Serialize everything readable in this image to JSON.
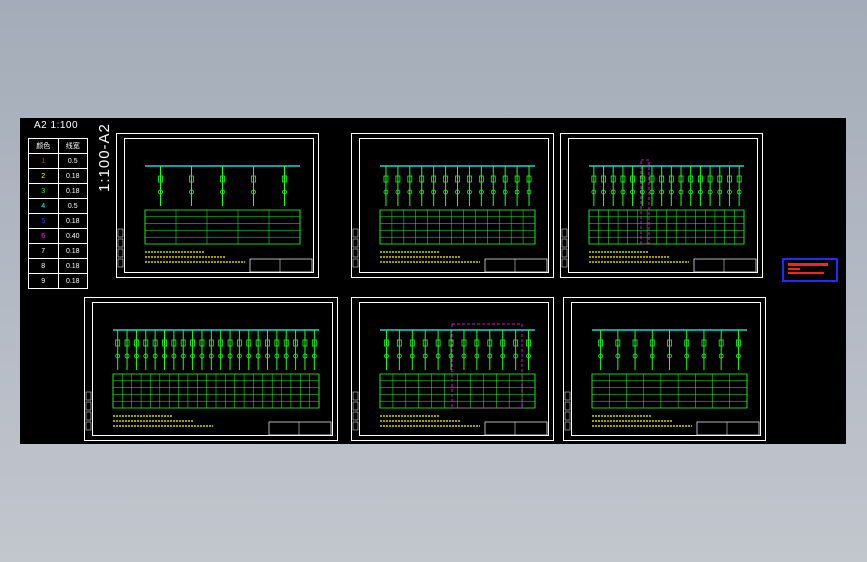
{
  "header": {
    "scale_label": "A2 1:100",
    "rotated_label": "1:100-A2"
  },
  "pen_table": {
    "headers": [
      "颜色",
      "线宽"
    ],
    "rows": [
      {
        "pen": "1",
        "width": "0.5",
        "color": "#ff2020"
      },
      {
        "pen": "2",
        "width": "0.18",
        "color": "#ffff00"
      },
      {
        "pen": "3",
        "width": "0.18",
        "color": "#20ff20"
      },
      {
        "pen": "4",
        "width": "0.5",
        "color": "#20ffff"
      },
      {
        "pen": "5",
        "width": "0.18",
        "color": "#2040ff"
      },
      {
        "pen": "6",
        "width": "0.40",
        "color": "#ff20ff"
      },
      {
        "pen": "7",
        "width": "0.18",
        "color": "#ffffff"
      },
      {
        "pen": "8",
        "width": "0.18",
        "color": "#ffffff"
      },
      {
        "pen": "9",
        "width": "0.18",
        "color": "#ffffff"
      }
    ]
  },
  "sheets": [
    {
      "id": "sheet-1",
      "feeders": 5
    },
    {
      "id": "sheet-2",
      "feeders": 13
    },
    {
      "id": "sheet-3",
      "feeders": 16
    },
    {
      "id": "sheet-4",
      "feeders": 22
    },
    {
      "id": "sheet-5",
      "feeders": 12
    },
    {
      "id": "sheet-6",
      "feeders": 9
    }
  ],
  "colors": {
    "green": "#20ff20",
    "cyan": "#20ffff",
    "yellow": "#ffff00",
    "magenta": "#ff20ff",
    "white": "#ffffff",
    "red": "#ff2020",
    "blue": "#1f2bff"
  }
}
